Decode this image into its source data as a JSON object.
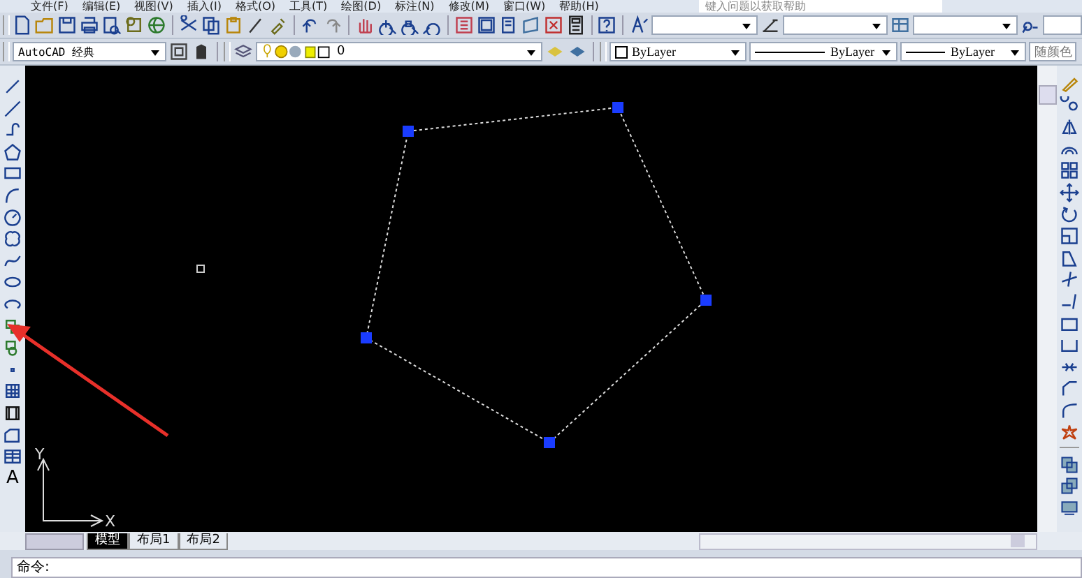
{
  "menu_bar": {
    "items": [
      "文件(F)",
      "编辑(E)",
      "视图(V)",
      "插入(I)",
      "格式(O)",
      "工具(T)",
      "绘图(D)",
      "标注(N)",
      "修改(M)",
      "窗口(W)",
      "帮助(H)"
    ],
    "help_search": {
      "placeholder": "键入问题以获取帮助"
    }
  },
  "workspace": {
    "value": "AutoCAD 经典"
  },
  "layer": {
    "value": "0"
  },
  "properties": {
    "color_setting": "ByLayer",
    "linetype": "ByLayer",
    "lineweight": "ByLayer",
    "plot_style": "随颜色"
  },
  "draw_toolbar": {
    "text_glyph": "A"
  },
  "layout_tabs": [
    {
      "label": "模型",
      "selected": true
    },
    {
      "label": "布局1",
      "selected": false
    },
    {
      "label": "布局2",
      "selected": false
    }
  ],
  "ucs": {
    "x_label": "X",
    "y_label": "Y"
  },
  "command_line": {
    "prompt": "命令:"
  }
}
